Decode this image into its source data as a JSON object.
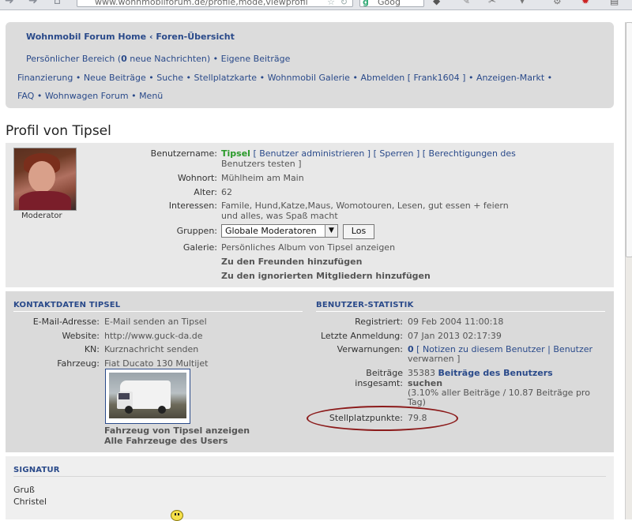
{
  "browser": {
    "url": "www.wohnmobilforum.de/profile,mode,viewprofil",
    "search_text": "Goog"
  },
  "nav": {
    "home": "Wohnmobil Forum Home",
    "forum_overview": "Foren-Übersicht",
    "personal_area": "Persönlicher Bereich (",
    "new_messages_count": "0",
    "new_messages_suffix": " neue Nachrichten)",
    "own_posts": "Eigene Beiträge",
    "links_row1": [
      "Finanzierung",
      "Neue Beiträge",
      "Suche",
      "Stellplatzkarte",
      "Wohnmobil Galerie",
      "Abmelden [ Frank1604 ]",
      "Anzeigen-Markt"
    ],
    "links_row2": [
      "FAQ",
      "Wohnwagen Forum",
      "Menü"
    ],
    "separator": "•",
    "arrow": "‹"
  },
  "page_title": "Profil von Tipsel",
  "profile": {
    "rank": "Moderator",
    "username_label": "Benutzername:",
    "username": "Tipsel",
    "admin_links_line1": "[ Benutzer administrieren ] [ Sperren ] [ Berechtigungen des",
    "admin_links_line2": "Benutzers testen ]",
    "location_label": "Wohnort:",
    "location": "Mühlheim am Main",
    "age_label": "Alter:",
    "age": "62",
    "interests_label": "Interessen:",
    "interests_line1": "Famile, Hund,Katze,Maus, Womotouren, Lesen, gut essen + feiern",
    "interests_line2": "und alles, was Spaß macht",
    "groups_label": "Gruppen:",
    "groups_selected": "Globale Moderatoren",
    "go_button": "Los",
    "gallery_label": "Galerie:",
    "gallery_link": "Persönliches Album von Tipsel anzeigen",
    "add_friend": "Zu den Freunden hinzufügen",
    "add_ignored": "Zu den ignorierten Mitgliedern hinzufügen"
  },
  "contact": {
    "heading": "KONTAKTDATEN TIPSEL",
    "email_label": "E-Mail-Adresse:",
    "email_link": "E-Mail senden an Tipsel",
    "website_label": "Website:",
    "website": "http://www.guck-da.de",
    "pm_label": "KN:",
    "pm_link": "Kurznachricht senden",
    "vehicle_label": "Fahrzeug:",
    "vehicle": "Fiat Ducato 130 Multijet",
    "vehicle_show": "Fahrzeug von Tipsel anzeigen",
    "vehicles_all": "Alle Fahrzeuge des Users"
  },
  "stats": {
    "heading": "BENUTZER-STATISTIK",
    "registered_label": "Registriert:",
    "registered": "09 Feb 2004 11:00:18",
    "last_login_label": "Letzte Anmeldung:",
    "last_login": "07 Jan 2013 02:17:39",
    "warnings_label": "Verwarnungen:",
    "warnings_count": "0",
    "warnings_links_line1": "[ Notizen zu diesem Benutzer | Benutzer",
    "warnings_links_line2": "verwarnen ]",
    "posts_label_line1": "Beiträge",
    "posts_label_line2": "insgesamt:",
    "posts_count": "35383",
    "posts_search_line1": "Beiträge des Benutzers",
    "posts_search_line2": "suchen",
    "posts_ratio_line1": "(3.10% aller Beiträge / 10.87 Beiträge pro",
    "posts_ratio_line2": "Tag)",
    "pitch_points_label": "Stellplatzpunkte:",
    "pitch_points": "79.8"
  },
  "signature": {
    "heading": "SIGNATUR",
    "line1": "Gruß",
    "line2": "Christel"
  },
  "colors": {
    "link": "#2a4a8a",
    "username_green": "#2a9a2a",
    "highlight_ellipse": "#8b1a1a",
    "panel_bg": "#dcdcdc"
  }
}
